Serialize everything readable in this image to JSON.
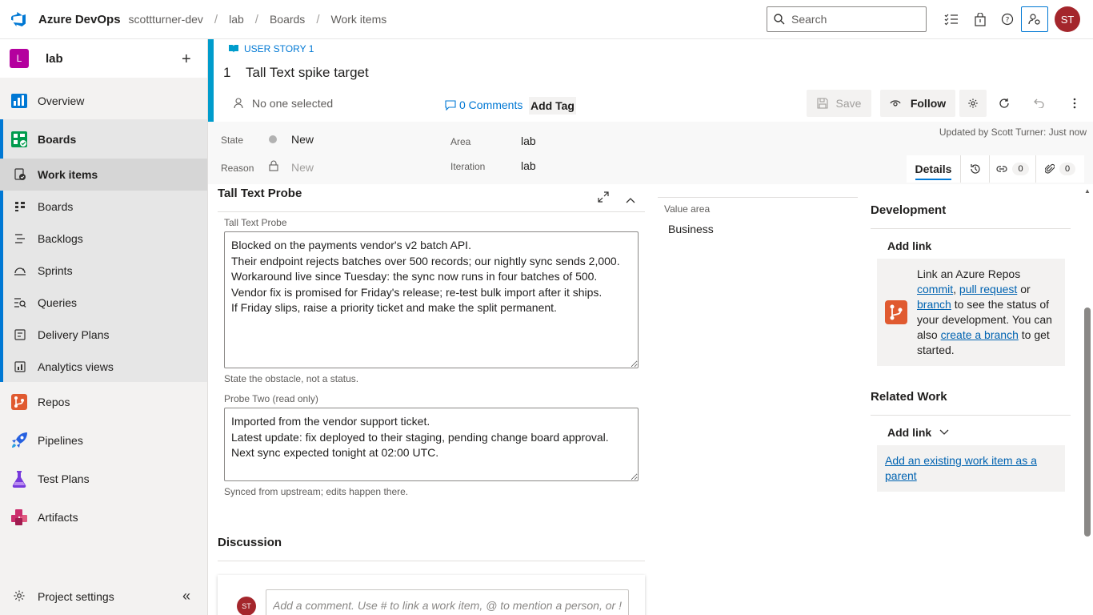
{
  "topbar": {
    "brand": "Azure DevOps",
    "org": "scottturner-dev",
    "breadcrumbs": [
      "lab",
      "Boards",
      "Work items"
    ],
    "search_placeholder": "Search",
    "avatar_initials": "ST"
  },
  "sidebar": {
    "project_initial": "L",
    "project_name": "lab",
    "items": [
      {
        "label": "Overview",
        "icon": "overview-icon"
      },
      {
        "label": "Boards",
        "icon": "boards-icon"
      },
      {
        "label": "Work items",
        "icon": "work-items-icon"
      },
      {
        "label": "Boards",
        "icon": "boards-sub-icon"
      },
      {
        "label": "Backlogs",
        "icon": "backlogs-icon"
      },
      {
        "label": "Sprints",
        "icon": "sprints-icon"
      },
      {
        "label": "Queries",
        "icon": "queries-icon"
      },
      {
        "label": "Delivery Plans",
        "icon": "delivery-plans-icon"
      },
      {
        "label": "Analytics views",
        "icon": "analytics-icon"
      },
      {
        "label": "Repos",
        "icon": "repos-icon"
      },
      {
        "label": "Pipelines",
        "icon": "pipelines-icon"
      },
      {
        "label": "Test Plans",
        "icon": "test-plans-icon"
      },
      {
        "label": "Artifacts",
        "icon": "artifacts-icon"
      }
    ],
    "settings_label": "Project settings"
  },
  "work_item": {
    "type_label": "USER STORY 1",
    "id": "1",
    "title": "Tall Text spike target",
    "assignee": "No one selected",
    "comments_label": "0 Comments",
    "add_tag": "Add Tag",
    "save_label": "Save",
    "follow_label": "Follow",
    "updated_by": "Updated by Scott Turner: Just now"
  },
  "fields": {
    "state_label": "State",
    "state_value": "New",
    "reason_label": "Reason",
    "reason_value": "New",
    "area_label": "Area",
    "area_value": "lab",
    "iteration_label": "Iteration",
    "iteration_value": "lab",
    "tabs": {
      "details": "Details",
      "links_count": "0",
      "attachments_count": "0"
    }
  },
  "probe_section": {
    "title": "Tall Text Probe",
    "field1_label": "Tall Text Probe",
    "field1_value": "Blocked on the payments vendor's v2 batch API.\nTheir endpoint rejects batches over 500 records; our nightly sync sends 2,000.\nWorkaround live since Tuesday: the sync now runs in four batches of 500.\nVendor fix is promised for Friday's release; re-test bulk import after it ships.\nIf Friday slips, raise a priority ticket and make the split permanent.",
    "field1_help": "State the obstacle, not a status.",
    "field2_label": "Probe Two (read only)",
    "field2_value": "Imported from the vendor support ticket.\nLatest update: fix deployed to their staging, pending change board approval.\nNext sync expected tonight at 02:00 UTC.",
    "field2_help": "Synced from upstream; edits happen there."
  },
  "value_area": {
    "label": "Value area",
    "value": "Business"
  },
  "development": {
    "title": "Development",
    "add_link": "Add link",
    "text_1": "Link an Azure Repos",
    "link_commit": "commit",
    "text_comma": ",",
    "link_pr": "pull request",
    "text_or": "or",
    "link_branch": "branch",
    "text_2": "to see the status of your development. You can also",
    "link_create_branch": "create a branch",
    "text_3": "to get started."
  },
  "related_work": {
    "title": "Related Work",
    "add_link": "Add link",
    "existing_parent": "Add an existing work item as a parent"
  },
  "discussion": {
    "title": "Discussion",
    "avatar_initials": "ST",
    "placeholder": "Add a comment. Use # to link a work item, @ to mention a person, or !"
  },
  "colors": {
    "accent": "#0078d4",
    "user_story": "#009ccc",
    "avatar": "#a4262c",
    "project_badge": "#b4009e"
  }
}
